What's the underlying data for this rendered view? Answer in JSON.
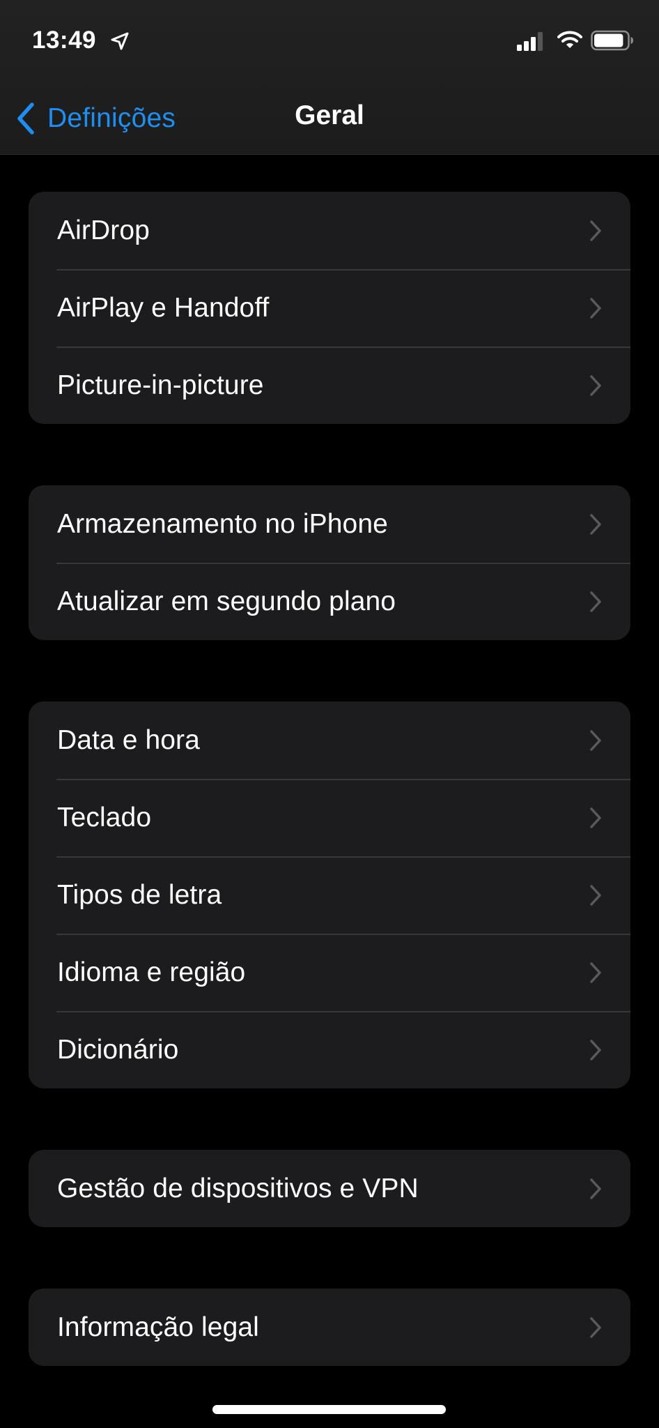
{
  "status_bar": {
    "time": "13:49",
    "location_icon": "location-arrow-icon",
    "signal_icon": "cellular-signal-icon",
    "signal_bars_filled": 3,
    "signal_bars_total": 4,
    "wifi_icon": "wifi-icon",
    "battery_icon": "battery-icon",
    "battery_level": 0.9
  },
  "nav": {
    "back_icon": "chevron-left-icon",
    "back_label": "Definições",
    "title": "Geral"
  },
  "colors": {
    "accent": "#1f8ef1",
    "background": "#000000",
    "cell_background": "#1c1c1e",
    "separator": "#38383a",
    "chevron": "#5a5a5e"
  },
  "groups": [
    {
      "items": [
        {
          "label": "AirDrop",
          "icon": "chevron-right-icon"
        },
        {
          "label": "AirPlay e Handoff",
          "icon": "chevron-right-icon"
        },
        {
          "label": "Picture-in-picture",
          "icon": "chevron-right-icon"
        }
      ]
    },
    {
      "items": [
        {
          "label": "Armazenamento no iPhone",
          "icon": "chevron-right-icon"
        },
        {
          "label": "Atualizar em segundo plano",
          "icon": "chevron-right-icon"
        }
      ]
    },
    {
      "items": [
        {
          "label": "Data e hora",
          "icon": "chevron-right-icon"
        },
        {
          "label": "Teclado",
          "icon": "chevron-right-icon"
        },
        {
          "label": "Tipos de letra",
          "icon": "chevron-right-icon"
        },
        {
          "label": "Idioma e região",
          "icon": "chevron-right-icon"
        },
        {
          "label": "Dicionário",
          "icon": "chevron-right-icon"
        }
      ]
    },
    {
      "items": [
        {
          "label": "Gestão de dispositivos e VPN",
          "icon": "chevron-right-icon"
        }
      ]
    },
    {
      "items": [
        {
          "label": "Informação legal",
          "icon": "chevron-right-icon"
        }
      ]
    }
  ]
}
